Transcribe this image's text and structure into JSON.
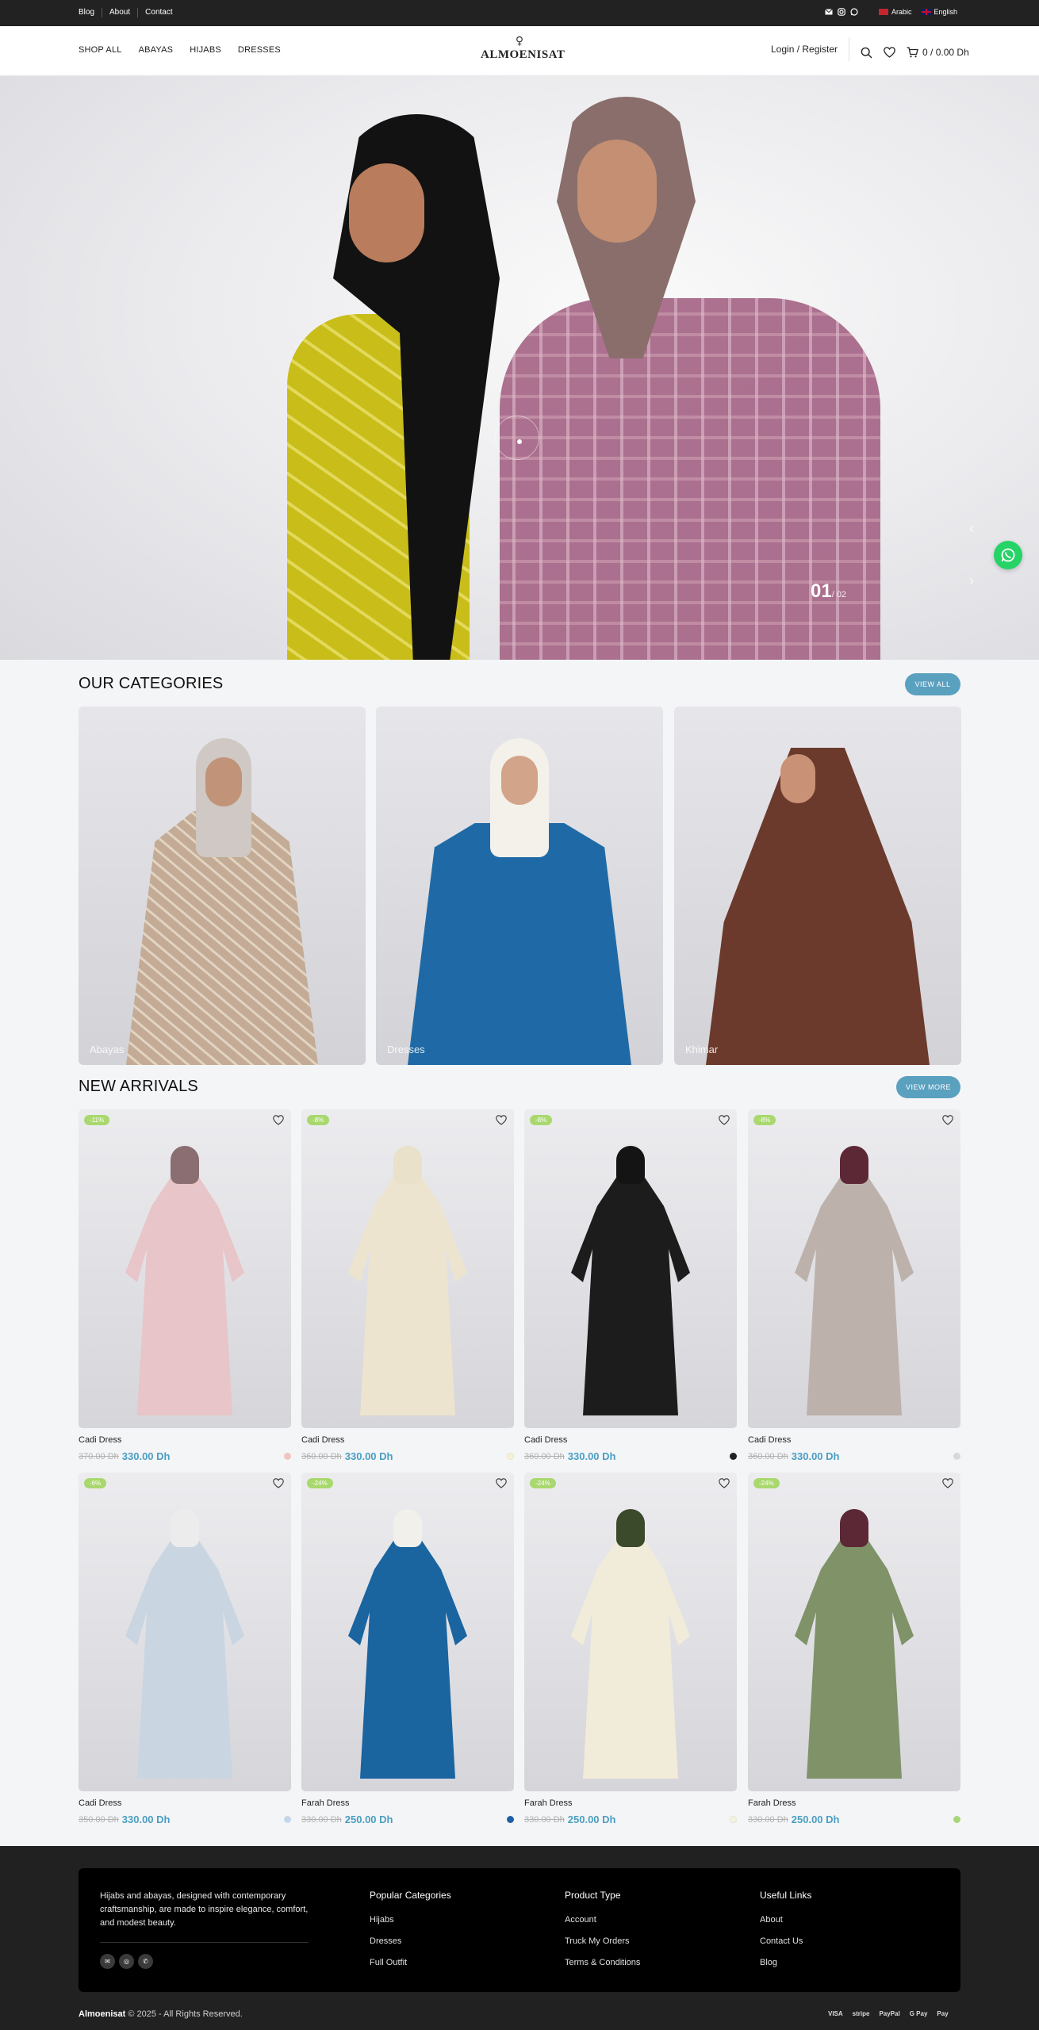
{
  "topbar": {
    "links": [
      "Blog",
      "About",
      "Contact"
    ],
    "languages": [
      {
        "label": "Arabic",
        "flag": "ar"
      },
      {
        "label": "English",
        "flag": "en"
      }
    ]
  },
  "header": {
    "nav": [
      "SHOP ALL",
      "ABAYAS",
      "HIJABS",
      "DRESSES"
    ],
    "logo_mark": "♀",
    "logo": "ALMOENISAT",
    "login": "Login / Register",
    "cart": "0 / 0.00 Dh"
  },
  "hero": {
    "slide_current": "01",
    "slide_total": "/ 02"
  },
  "categories": {
    "title": "OUR CATEGORIES",
    "button": "VIEW ALL",
    "items": [
      {
        "label": "Abayas",
        "hijab": "#cfc8c4",
        "dress": "#c9b4a0"
      },
      {
        "label": "Dresses",
        "hijab": "#f3f1ea",
        "dress": "#1f6aa6"
      },
      {
        "label": "Khimar",
        "hijab": "#6b3a2c",
        "dress": "#6b3a2c"
      }
    ]
  },
  "arrivals": {
    "title": "NEW ARRIVALS",
    "button": "VIEW MORE",
    "products": [
      {
        "name": "Cadi Dress",
        "old": "370.00 Dh",
        "price": "330.00 Dh",
        "badge": "-11%",
        "swatch": "#f0c4c4",
        "hijab": "#8a6e72",
        "dress": "#e8c5c8"
      },
      {
        "name": "Cadi Dress",
        "old": "360.00 Dh",
        "price": "330.00 Dh",
        "badge": "-8%",
        "swatch": "#f6f2d8",
        "hijab": "#e9e1c9",
        "dress": "#ece4cf"
      },
      {
        "name": "Cadi Dress",
        "old": "360.00 Dh",
        "price": "330.00 Dh",
        "badge": "-8%",
        "swatch": "#222222",
        "hijab": "#141414",
        "dress": "#1c1c1c"
      },
      {
        "name": "Cadi Dress",
        "old": "360.00 Dh",
        "price": "330.00 Dh",
        "badge": "-8%",
        "swatch": "#d8d8d8",
        "hijab": "#5c2836",
        "dress": "#bcb2ab"
      },
      {
        "name": "Cadi Dress",
        "old": "350.00 Dh",
        "price": "330.00 Dh",
        "badge": "-6%",
        "swatch": "#c4d6ea",
        "hijab": "#ececec",
        "dress": "#c9d6e2"
      },
      {
        "name": "Farah Dress",
        "old": "330.00 Dh",
        "price": "250.00 Dh",
        "badge": "-24%",
        "swatch": "#1f5fa6",
        "hijab": "#f2f0ea",
        "dress": "#1a64a0"
      },
      {
        "name": "Farah Dress",
        "old": "330.00 Dh",
        "price": "250.00 Dh",
        "badge": "-24%",
        "swatch": "#f4f2e2",
        "hijab": "#3c4a2c",
        "dress": "#f1ecda"
      },
      {
        "name": "Farah Dress",
        "old": "330.00 Dh",
        "price": "250.00 Dh",
        "badge": "-24%",
        "swatch": "#a6d67a",
        "hijab": "#5c2836",
        "dress": "#7f9268"
      }
    ]
  },
  "footer": {
    "about": "Hijabs and abayas, designed with contemporary craftsmanship, are made to inspire elegance, comfort, and modest beauty.",
    "columns": [
      {
        "title": "Popular Categories",
        "links": [
          "Hijabs",
          "Dresses",
          "Full Outfit"
        ]
      },
      {
        "title": "Product Type",
        "links": [
          "Account",
          "Truck My Orders",
          "Terms & Conditions"
        ]
      },
      {
        "title": "Useful Links",
        "links": [
          "About",
          "Contact Us",
          "Blog"
        ]
      }
    ],
    "brand": "Almoenisat",
    "copyright": " © 2025 - All Rights Reserved.",
    "payments": [
      "VISA",
      "stripe",
      "PayPal",
      "G Pay",
      " Pay"
    ]
  }
}
